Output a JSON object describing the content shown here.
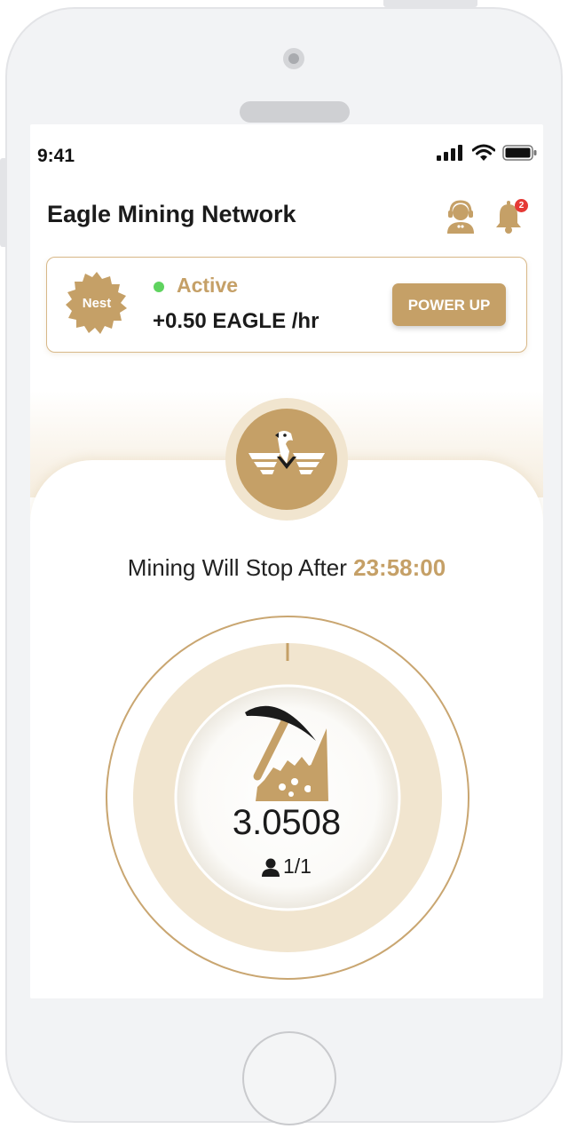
{
  "status_bar": {
    "time": "9:41"
  },
  "header": {
    "title": "Eagle Mining Network",
    "notification_count": "2"
  },
  "status_card": {
    "tier": "Nest",
    "status": "Active",
    "rate": "+0.50 EAGLE /hr",
    "power_up_label": "POWER UP"
  },
  "mining": {
    "stop_label": "Mining Will Stop After",
    "countdown": "23:58:00",
    "balance": "3.0508",
    "referrals": "1/1"
  },
  "colors": {
    "accent": "#c5a067",
    "accent_light": "#f1e5cf",
    "active_dot": "#5fd35f",
    "badge": "#e53935"
  },
  "icons": [
    "support-agent-icon",
    "bell-icon",
    "eagle-logo-icon",
    "pickaxe-icon",
    "user-icon",
    "signal-icon",
    "wifi-icon",
    "battery-icon"
  ]
}
